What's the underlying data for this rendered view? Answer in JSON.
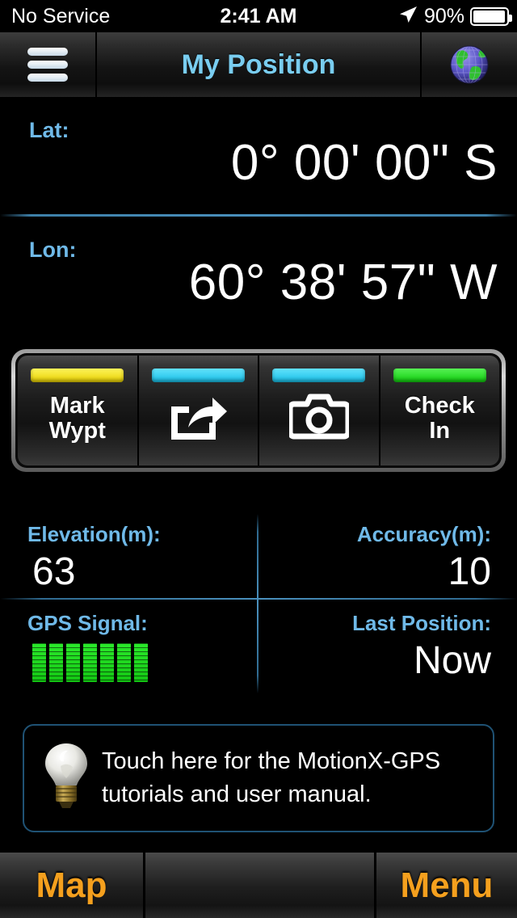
{
  "status_bar": {
    "carrier": "No Service",
    "time": "2:41 AM",
    "battery_percent": "90%",
    "location_icon": "location-arrow-icon",
    "battery_icon": "battery-icon"
  },
  "nav_bar": {
    "menu_icon": "hamburger-menu-icon",
    "title": "My Position",
    "globe_icon": "globe-icon"
  },
  "coordinates": {
    "lat_label": "Lat:",
    "lat_value": "0° 00' 00\" S",
    "lon_label": "Lon:",
    "lon_value": "60° 38' 57\" W"
  },
  "action_bar": {
    "buttons": [
      {
        "label": "Mark\nWypt",
        "label_line1": "Mark",
        "label_line2": "Wypt",
        "strip_color": "#f5e315",
        "icon": null,
        "type": "text"
      },
      {
        "label": "",
        "strip_color": "#2fd0f5",
        "icon": "share-icon",
        "type": "icon"
      },
      {
        "label": "",
        "strip_color": "#2fd0f5",
        "icon": "camera-icon",
        "type": "icon"
      },
      {
        "label": "Check\nIn",
        "label_line1": "Check",
        "label_line2": "In",
        "strip_color": "#21e21f",
        "icon": null,
        "type": "text"
      }
    ]
  },
  "stats": {
    "elevation_label": "Elevation(m):",
    "elevation_value": "63",
    "accuracy_label": "Accuracy(m):",
    "accuracy_value": "10",
    "gps_signal_label": "GPS Signal:",
    "gps_signal_bars": 7,
    "gps_signal_bar_color": "#1fdc1f",
    "last_position_label": "Last Position:",
    "last_position_value": "Now"
  },
  "tutorial": {
    "icon": "lightbulb-icon",
    "line1": "Touch here for the MotionX-GPS",
    "line2": "tutorials and user manual.",
    "border_color": "#1f5274"
  },
  "toolbar": {
    "map_label": "Map",
    "menu_label": "Menu",
    "accent_color": "#f5a01e"
  },
  "theme": {
    "background": "#000000",
    "label_blue": "#6fb9e8",
    "title_blue": "#79cdf0",
    "divider_blue": "#4a90bd"
  }
}
